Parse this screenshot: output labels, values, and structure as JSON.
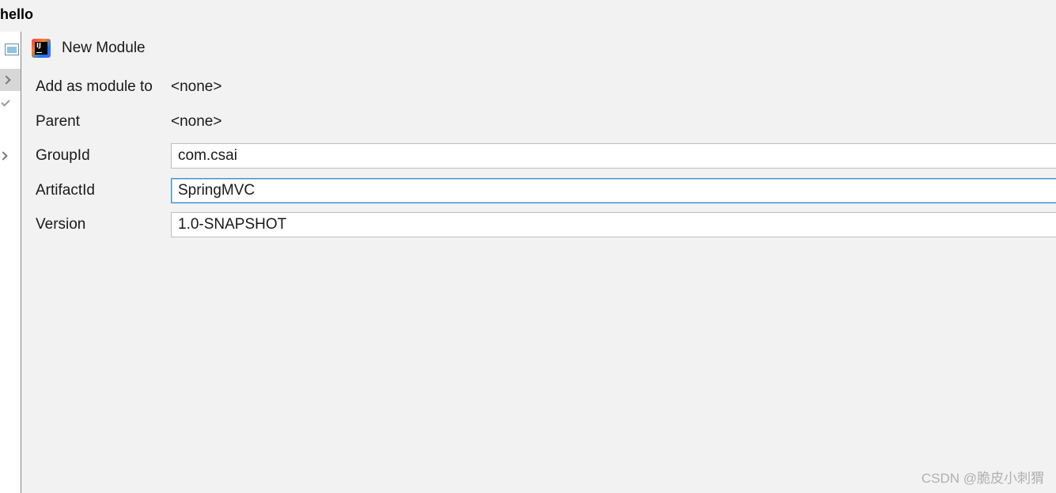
{
  "window": {
    "title": "hello"
  },
  "dialog": {
    "title": "New Module",
    "logo_icon": "intellij-idea-icon"
  },
  "sidebar": {
    "items": [
      {
        "icon": "window-icon"
      },
      {
        "icon": "chevron-right-icon",
        "selected": true
      },
      {
        "icon": "check-icon"
      },
      {
        "icon": "chevron-right-icon"
      }
    ]
  },
  "form": {
    "add_as_module_label": "Add as module to",
    "add_as_module_value": "<none>",
    "parent_label": "Parent",
    "parent_value": "<none>",
    "group_id_label": "GroupId",
    "group_id_value": "com.csai",
    "artifact_id_label": "ArtifactId",
    "artifact_id_value": "SpringMVC",
    "version_label": "Version",
    "version_value": "1.0-SNAPSHOT"
  },
  "watermark": "CSDN @脆皮小刺猬",
  "colors": {
    "background": "#f2f2f2",
    "focus_border": "#3d8fd1",
    "field_border": "#bdbdbd"
  }
}
